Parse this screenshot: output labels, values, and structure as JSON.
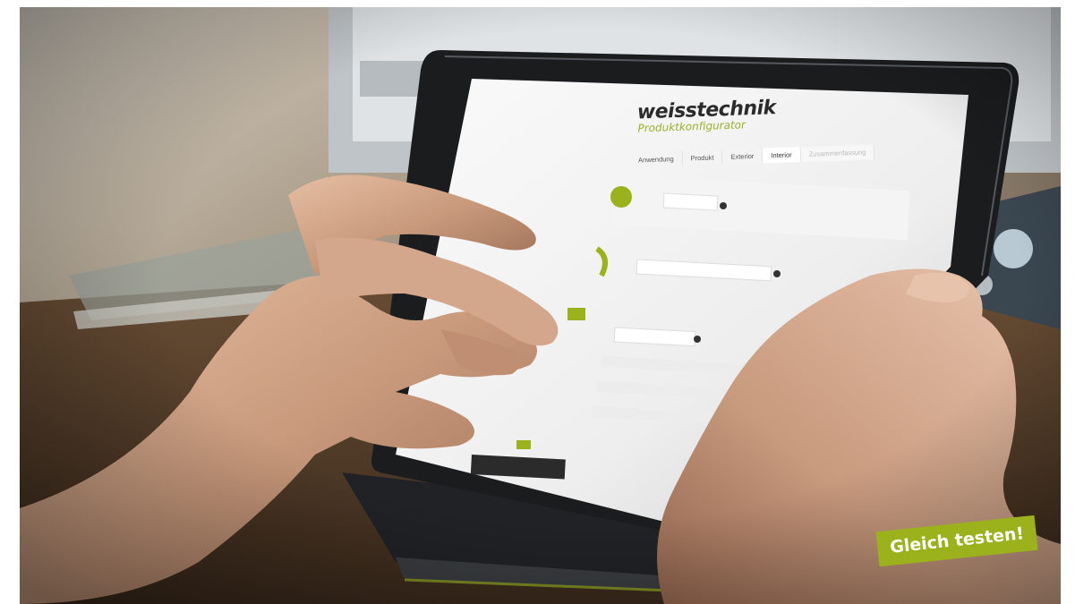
{
  "brand": {
    "name": "weisstechnik",
    "subtitle": "Produktkonfigurator"
  },
  "tabs": [
    {
      "label": "Anwendung"
    },
    {
      "label": "Produkt"
    },
    {
      "label": "Exterior"
    },
    {
      "label": "Interior"
    },
    {
      "label": "Zusammenfassung"
    }
  ],
  "cta": {
    "label": "Gleich testen!",
    "color": "#9cb21d"
  },
  "colors": {
    "accent": "#9cb21d",
    "skin": "#c89a7e"
  }
}
